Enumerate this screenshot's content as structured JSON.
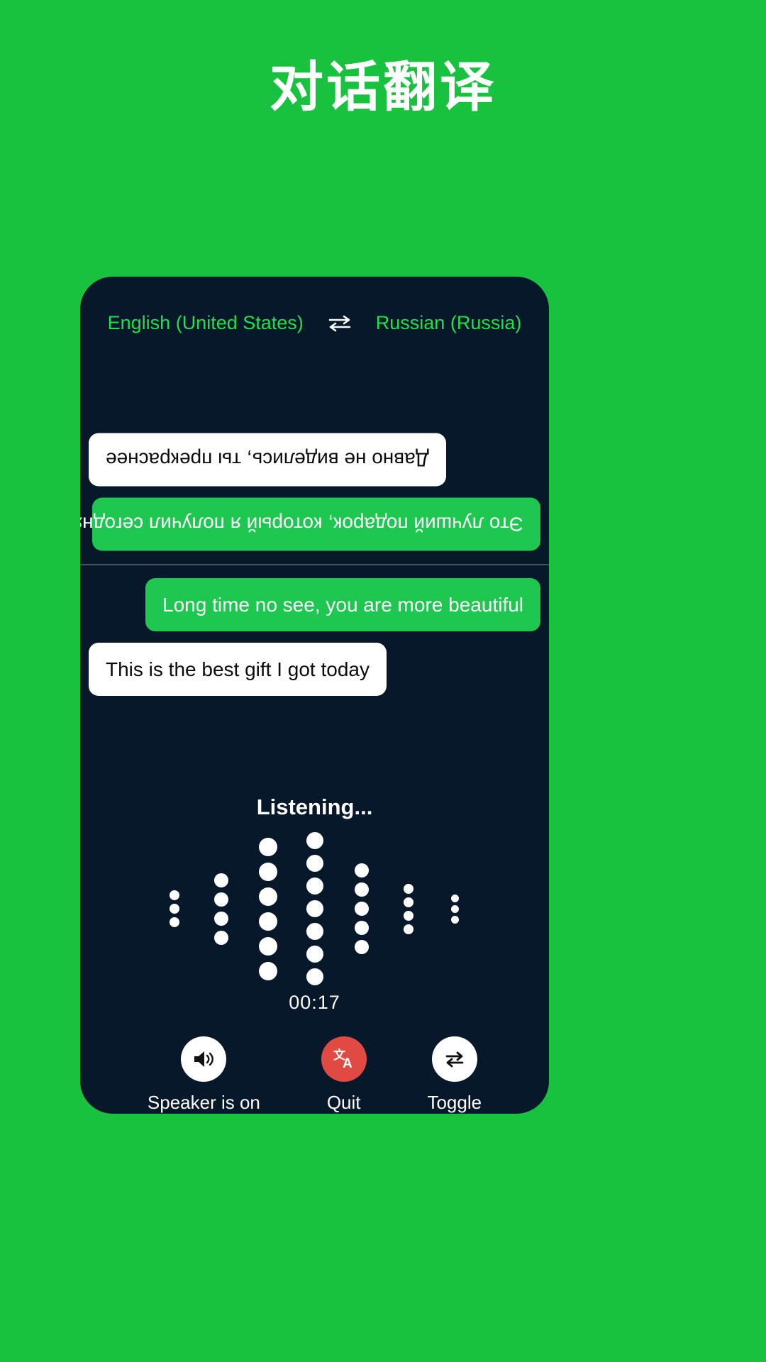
{
  "header": {
    "title": "对话翻译"
  },
  "colors": {
    "background": "#18c23f",
    "card": "#08182b",
    "accent_green": "#1ec750",
    "lang_green": "#1ee04a",
    "quit_red": "#e04a42",
    "white": "#ffffff",
    "divider": "#44505e"
  },
  "language_bar": {
    "source_language": "English (United States)",
    "swap_icon": "swap-horizontal-icon",
    "target_language": "Russian (Russia)"
  },
  "conversation": {
    "remote_pane": {
      "rotated": true,
      "messages": [
        {
          "text": "Это лучший подарок, который я получил сегодня",
          "style": "green",
          "align": "left"
        },
        {
          "text": "Давно не виделись, ты прекраснее",
          "style": "white",
          "align": "right"
        }
      ]
    },
    "local_pane": {
      "rotated": false,
      "messages": [
        {
          "text": "Long time no see, you are more beautiful",
          "style": "green",
          "align": "right"
        },
        {
          "text": "This is the best gift I got today",
          "style": "white",
          "align": "left"
        }
      ]
    }
  },
  "listening": {
    "label": "Listening...",
    "timer": "00:17",
    "visualizer": {
      "type": "dot-waveform",
      "columns": [
        {
          "dots": 3,
          "size": 14
        },
        {
          "dots": 4,
          "size": 20
        },
        {
          "dots": 6,
          "size": 26
        },
        {
          "dots": 7,
          "size": 24
        },
        {
          "dots": 5,
          "size": 20
        },
        {
          "dots": 4,
          "size": 14
        },
        {
          "dots": 3,
          "size": 11
        }
      ]
    }
  },
  "controls": [
    {
      "id": "speaker",
      "icon": "speaker-on-icon",
      "label": "Speaker is on",
      "circle": "white"
    },
    {
      "id": "quit",
      "icon": "translate-icon",
      "label": "Quit",
      "circle": "red"
    },
    {
      "id": "toggle",
      "icon": "swap-loop-icon",
      "label": "Toggle",
      "circle": "white"
    }
  ]
}
